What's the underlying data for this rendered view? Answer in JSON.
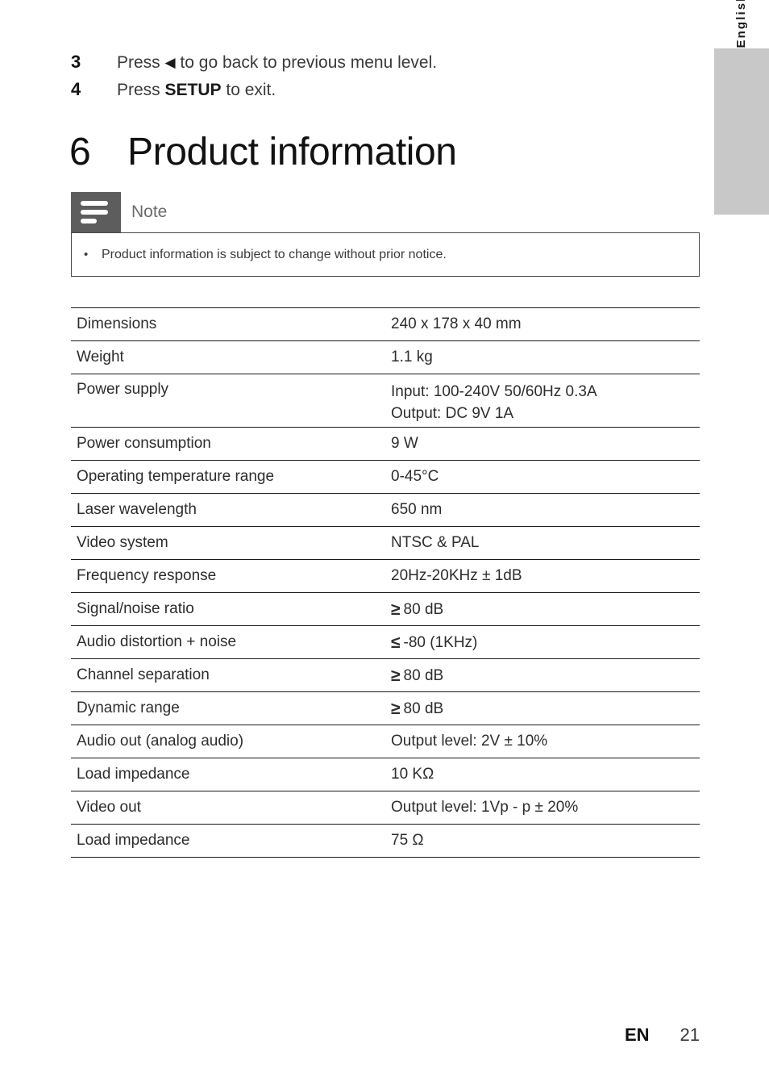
{
  "language_tab": {
    "label": "English"
  },
  "steps": [
    {
      "number": "3",
      "prefix": "Press ",
      "icon": "◀",
      "suffix": " to go back to previous menu level."
    },
    {
      "number": "4",
      "prefix": "Press ",
      "bold": "SETUP",
      "suffix": " to exit."
    }
  ],
  "chapter": {
    "number": "6",
    "title": "Product information"
  },
  "note": {
    "title": "Note",
    "bullet": "•",
    "text": "Product information is subject to change without prior notice."
  },
  "spec_table": {
    "rows": [
      {
        "label": "Dimensions",
        "value": "240 x 178 x 40 mm"
      },
      {
        "label": "Weight",
        "value": "1.1 kg"
      },
      {
        "label": "Power supply",
        "value_lines": [
          "Input: 100-240V 50/60Hz 0.3A",
          "Output: DC 9V 1A"
        ]
      },
      {
        "label": "Power consumption",
        "value": "9 W"
      },
      {
        "label": "Operating temperature range",
        "value": "0-45°C"
      },
      {
        "label": "Laser wavelength",
        "value": "650 nm"
      },
      {
        "label": "Video system",
        "value": "NTSC & PAL"
      },
      {
        "label": "Frequency response",
        "value": "20Hz-20KHz ± 1dB"
      },
      {
        "label": "Signal/noise ratio",
        "symbol": "≥",
        "value": "80 dB"
      },
      {
        "label": "Audio distortion + noise",
        "symbol": "≤",
        "value": "-80 (1KHz)"
      },
      {
        "label": "Channel separation",
        "symbol": "≥",
        "value": "80 dB"
      },
      {
        "label": "Dynamic range",
        "symbol": "≥",
        "value": "80 dB"
      },
      {
        "label": "Audio out (analog audio)",
        "value": "Output level: 2V ± 10%"
      },
      {
        "label": "Load impedance",
        "value": "10 KΩ"
      },
      {
        "label": "Video out",
        "value": "Output level: 1Vp - p ± 20%"
      },
      {
        "label": "Load impedance",
        "value": "75 Ω"
      }
    ]
  },
  "footer": {
    "lang_code": "EN",
    "page_number": "21"
  },
  "colors": {
    "note_icon_bg": "#5d5d5d",
    "note_title_text": "#6b6b6b",
    "lang_tab_bg": "#c8c8c8",
    "rule": "#1a1a1a"
  }
}
